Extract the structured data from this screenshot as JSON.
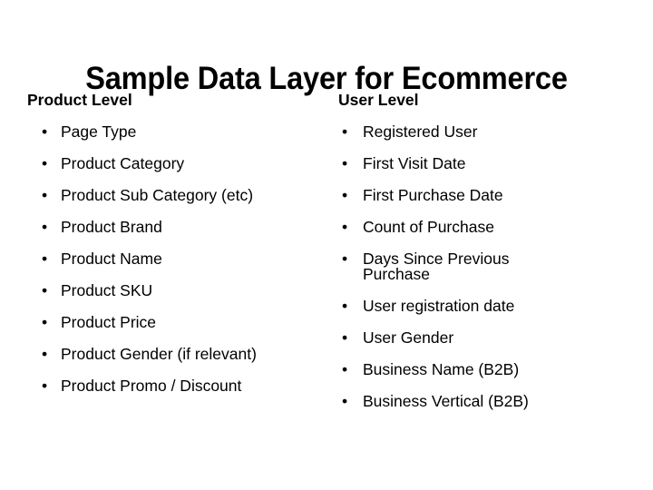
{
  "slide": {
    "title": "Sample Data Layer for Ecommerce",
    "background_color": "#ffffff",
    "text_color": "#000000",
    "bullet_glyph": "•"
  },
  "columns": [
    {
      "id": "product-level",
      "heading": "Product Level",
      "items": [
        "Page Type",
        "Product Category",
        "Product Sub Category (etc)",
        "Product Brand",
        "Product Name",
        "Product SKU",
        "Product Price",
        "Product Gender (if relevant)",
        "Product Promo / Discount"
      ]
    },
    {
      "id": "user-level",
      "heading": "User Level",
      "items": [
        "Registered User",
        "First Visit Date",
        "First Purchase Date",
        "Count of Purchase",
        "Days Since Previous Purchase",
        "User registration date",
        "User Gender",
        "Business Name (B2B)",
        "Business Vertical (B2B)"
      ]
    }
  ]
}
